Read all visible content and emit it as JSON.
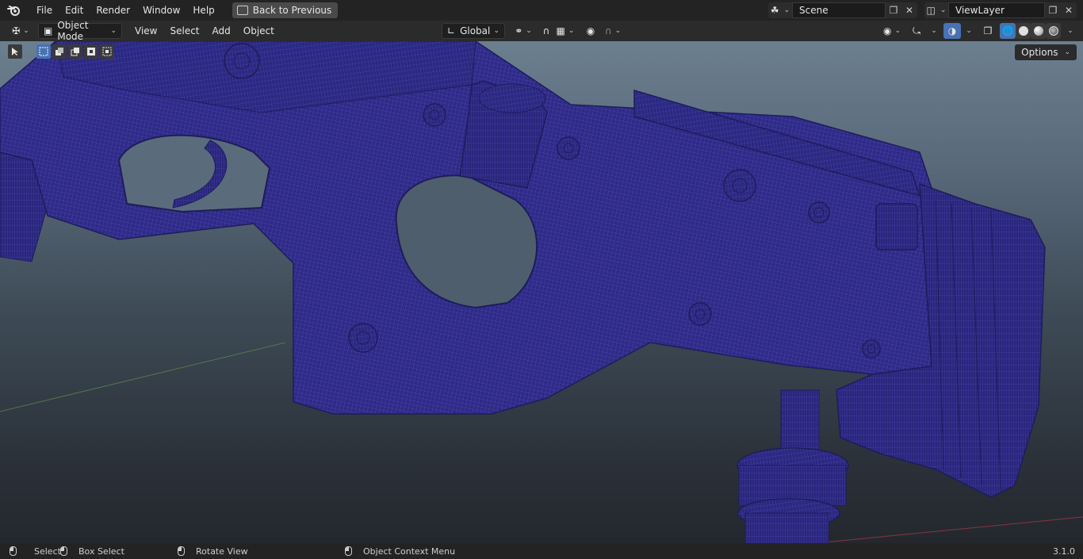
{
  "topbar": {
    "menus": [
      "File",
      "Edit",
      "Render",
      "Window",
      "Help"
    ],
    "back_button": "Back to Previous",
    "scene": "Scene",
    "view_layer": "ViewLayer"
  },
  "header": {
    "mode": "Object Mode",
    "menus": [
      "View",
      "Select",
      "Add",
      "Object"
    ],
    "transform_orientation": "Global"
  },
  "viewport": {
    "options_label": "Options",
    "mesh_color": "#2e2a86"
  },
  "statusbar": {
    "items": [
      "Select",
      "Box Select",
      "Rotate View",
      "Object Context Menu"
    ],
    "version": "3.1.0"
  },
  "colors": {
    "accent": "#4772b3",
    "mesh": "#2e2a86",
    "wire": "#4a48b0"
  }
}
